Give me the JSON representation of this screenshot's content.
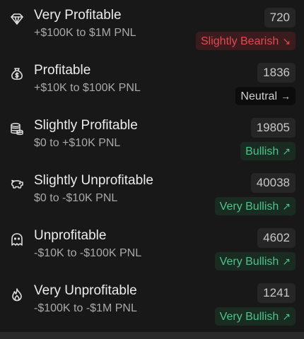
{
  "rows": [
    {
      "title": "Very Profitable",
      "range": "+$100K to $1M PNL",
      "count": "720",
      "sentiment": "Slightly Bearish",
      "sentiment_arrow": "↘",
      "icon": "diamond-icon",
      "sentiment_color": "#e5484d"
    },
    {
      "title": "Profitable",
      "range": "+$10K to $100K PNL",
      "count": "1836",
      "sentiment": "Neutral",
      "sentiment_arrow": "→",
      "icon": "money-bag-icon",
      "sentiment_color": "#d0d0d0"
    },
    {
      "title": "Slightly Profitable",
      "range": "$0 to +$10K PNL",
      "count": "19805",
      "sentiment": "Bullish",
      "sentiment_arrow": "↗",
      "icon": "coin-stack-icon",
      "sentiment_color": "#4cc38a"
    },
    {
      "title": "Slightly Unprofitable",
      "range": "$0 to -$10K PNL",
      "count": "40038",
      "sentiment": "Very Bullish",
      "sentiment_arrow": "↗",
      "icon": "piggy-bank-icon",
      "sentiment_color": "#4cc38a"
    },
    {
      "title": "Unprofitable",
      "range": "-$10K to -$100K PNL",
      "count": "4602",
      "sentiment": "Very Bullish",
      "sentiment_arrow": "↗",
      "icon": "ghost-icon",
      "sentiment_color": "#4cc38a"
    },
    {
      "title": "Very Unprofitable",
      "range": "-$100K to -$1M PNL",
      "count": "1241",
      "sentiment": "Very Bullish",
      "sentiment_arrow": "↗",
      "icon": "flame-icon",
      "sentiment_color": "#4cc38a"
    }
  ]
}
